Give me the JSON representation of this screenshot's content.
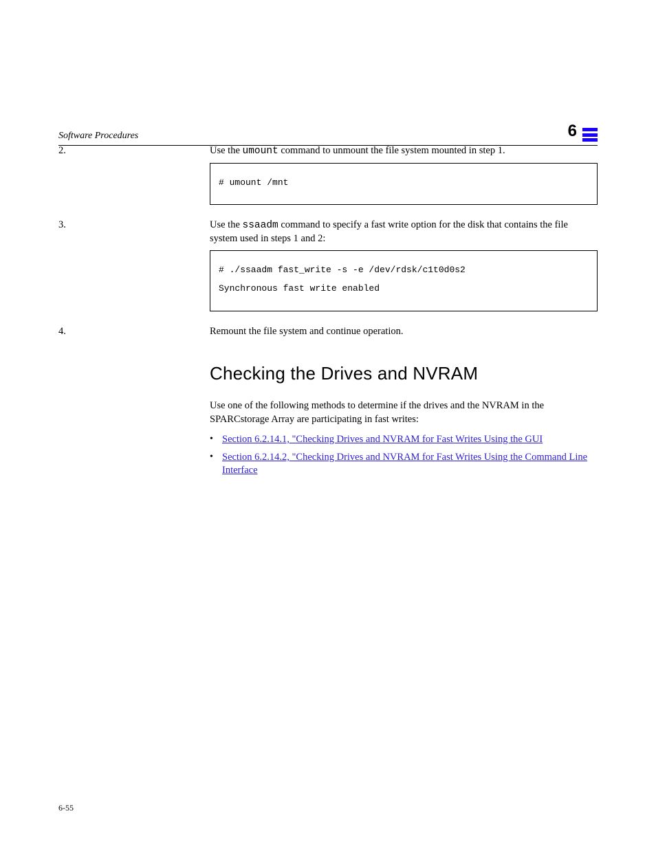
{
  "header": {
    "title": "Software Procedures",
    "section_tag": "6"
  },
  "steps": [
    {
      "label": "2.",
      "text_a": "Use the ",
      "cmd": "umount",
      "text_b": " command to unmount the file system mounted in step 1.",
      "code": "# umount /mnt"
    },
    {
      "label": "3.",
      "text_a": "Use the ",
      "cmd": "ssaadm",
      "text_b": " command to specify a fast write option for the disk that contains the file system used in steps 1 and 2:",
      "code": "# ./ssaadm fast_write -s -e /dev/rdsk/c1t0d0s2\nSynchronous fast write enabled"
    },
    {
      "label": "4.",
      "text_a": "Remount the file system and continue operation.",
      "cmd": "",
      "text_b": ""
    }
  ],
  "section": {
    "title": "Checking the Drives and NVRAM",
    "para": "Use one of the following methods to determine if the drives and the NVRAM in the SPARCstorage Array are participating in fast writes:",
    "bullets": [
      {
        "pre": "",
        "link": "Section 6.2.14.1, \"Checking Drives and NVRAM for Fast Writes Using the GUI",
        "post": ""
      },
      {
        "pre": "",
        "link": "Section 6.2.14.2, \"Checking Drives and NVRAM for Fast Writes Using the Command Line Interface",
        "post": ""
      }
    ]
  },
  "footer": {
    "text": "6-55"
  }
}
